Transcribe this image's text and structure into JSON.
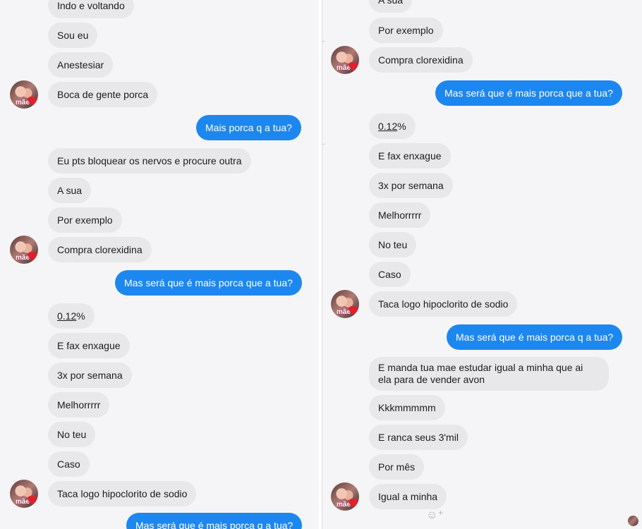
{
  "contact": {
    "avatar_label": "mãe"
  },
  "left_panel": {
    "messages": [
      {
        "text": "Indo e voltando",
        "dir": "in"
      },
      {
        "text": "Sou eu",
        "dir": "in"
      },
      {
        "text": "Anestesiar",
        "dir": "in"
      },
      {
        "text": "Boca de gente porca",
        "dir": "in"
      },
      {
        "text": "Mais porca q a tua?",
        "dir": "out"
      },
      {
        "text": "Eu pts bloquear os nervos e procure outra",
        "dir": "in"
      },
      {
        "text": "A sua",
        "dir": "in"
      },
      {
        "text": "Por exemplo",
        "dir": "in"
      },
      {
        "text": "Compra clorexidina",
        "dir": "in"
      },
      {
        "text": "Mas será que é mais porca que a tua?",
        "dir": "out"
      },
      {
        "text_underlined": "0.12",
        "text_rest": "%",
        "dir": "in"
      },
      {
        "text": "E fax enxague",
        "dir": "in"
      },
      {
        "text": "3x por semana",
        "dir": "in"
      },
      {
        "text": "Melhorrrrr",
        "dir": "in"
      },
      {
        "text": "No teu",
        "dir": "in"
      },
      {
        "text": "Caso",
        "dir": "in"
      },
      {
        "text": "Taca logo hipoclorito de sodio",
        "dir": "in"
      },
      {
        "text": "Mas será que é mais porca q a tua?",
        "dir": "out"
      }
    ]
  },
  "right_panel": {
    "messages": [
      {
        "text": "A sua",
        "dir": "in"
      },
      {
        "text": "Por exemplo",
        "dir": "in"
      },
      {
        "text": "Compra clorexidina",
        "dir": "in"
      },
      {
        "text": "Mas será que é mais porca que a tua?",
        "dir": "out"
      },
      {
        "text_underlined": "0.12",
        "text_rest": "%",
        "dir": "in"
      },
      {
        "text": "E fax enxague",
        "dir": "in"
      },
      {
        "text": "3x por semana",
        "dir": "in"
      },
      {
        "text": "Melhorrrrr",
        "dir": "in"
      },
      {
        "text": "No teu",
        "dir": "in"
      },
      {
        "text": "Caso",
        "dir": "in"
      },
      {
        "text": "Taca logo hipoclorito de sodio",
        "dir": "in"
      },
      {
        "text": "Mas será que é mais porca q a tua?",
        "dir": "out"
      },
      {
        "line1": "E manda tua mae estudar igual a minha que ai",
        "line2": "ela para de vender avon",
        "dir": "in"
      },
      {
        "text": "Kkkmmmmm",
        "dir": "in"
      },
      {
        "text": "E ranca seus 3'mil",
        "dir": "in"
      },
      {
        "text": "Por mês",
        "dir": "in"
      },
      {
        "text": "Igual a minha",
        "dir": "in"
      }
    ]
  },
  "icons": {
    "reaction": "smiley-add-icon"
  }
}
